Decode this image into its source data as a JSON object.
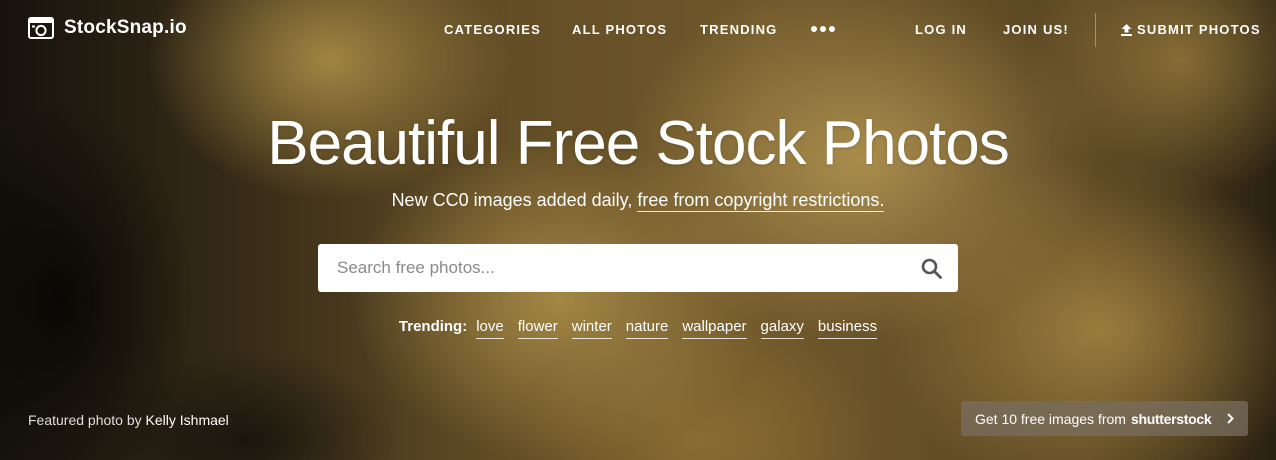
{
  "header": {
    "logo_text": "StockSnap.io",
    "nav": [
      "CATEGORIES",
      "ALL PHOTOS",
      "TRENDING"
    ],
    "more_icon": "more-dots-icon",
    "login": "LOG IN",
    "join": "JOIN US!",
    "submit": "SUBMIT PHOTOS"
  },
  "hero": {
    "title": "Beautiful Free Stock Photos",
    "subtitle_prefix": "New CC0 images added daily, ",
    "subtitle_link": "free from copyright restrictions."
  },
  "search": {
    "placeholder": "Search free photos...",
    "value": ""
  },
  "trending": {
    "label": "Trending:",
    "tags": [
      "love",
      "flower",
      "winter",
      "nature",
      "wallpaper",
      "galaxy",
      "business"
    ]
  },
  "footer": {
    "credit_prefix": "Featured photo by ",
    "credit_author": "Kelly Ishmael",
    "promo_text": "Get 10 free images from",
    "promo_brand": "shutterstock"
  },
  "colors": {
    "overlay": "#000000",
    "promo_bg": "#786e5f",
    "search_bg": "#ffffff"
  }
}
